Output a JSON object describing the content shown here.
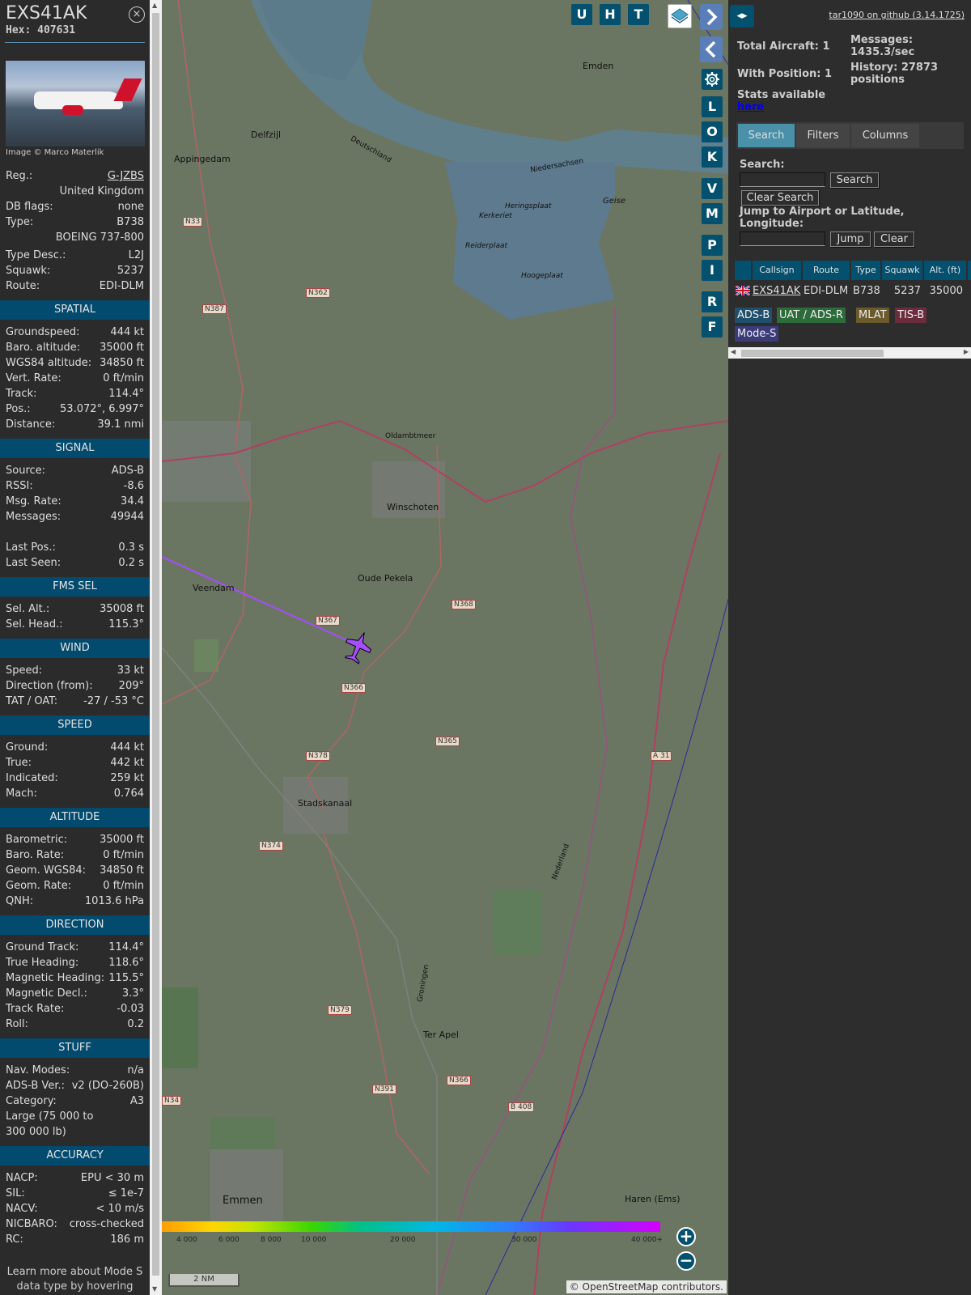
{
  "selected": {
    "callsign": "EXS41AK",
    "hex": "Hex: 407631",
    "close_icon": "×",
    "photo_credit": "Image © Marco Materlik",
    "info": [
      {
        "label": "Reg.:",
        "value": "G-JZBS",
        "link": true
      },
      {
        "label": "",
        "value": "United Kingdom"
      },
      {
        "label": "DB flags:",
        "value": "none"
      },
      {
        "label": "Type:",
        "value": "B738"
      },
      {
        "label": "",
        "value": "BOEING 737-800"
      },
      {
        "label": "Type Desc.:",
        "value": "L2J"
      },
      {
        "label": "Squawk:",
        "value": "5237"
      },
      {
        "label": "Route:",
        "value": "EDI-DLM"
      }
    ],
    "sections": [
      {
        "title": "SPATIAL",
        "rows": [
          {
            "label": "Groundspeed:",
            "value": "444 kt"
          },
          {
            "label": "Baro. altitude:",
            "value": "35000 ft"
          },
          {
            "label": "WGS84 altitude:",
            "value": "34850 ft"
          },
          {
            "label": "Vert. Rate:",
            "value": "0 ft/min"
          },
          {
            "label": "Track:",
            "value": "114.4°"
          },
          {
            "label": "Pos.:",
            "value": "53.072°, 6.997°"
          },
          {
            "label": "Distance:",
            "value": "39.1 nmi"
          }
        ]
      },
      {
        "title": "SIGNAL",
        "rows": [
          {
            "label": "Source:",
            "value": "ADS-B"
          },
          {
            "label": "RSSI:",
            "value": "-8.6"
          },
          {
            "label": "Msg. Rate:",
            "value": "34.4"
          },
          {
            "label": "Messages:",
            "value": "49944"
          },
          {
            "label": "",
            "value": ""
          },
          {
            "label": "Last Pos.:",
            "value": "0.3 s"
          },
          {
            "label": "Last Seen:",
            "value": "0.2 s"
          }
        ]
      },
      {
        "title": "FMS SEL",
        "rows": [
          {
            "label": "Sel. Alt.:",
            "value": "35008 ft"
          },
          {
            "label": "Sel. Head.:",
            "value": "115.3°"
          }
        ]
      },
      {
        "title": "WIND",
        "rows": [
          {
            "label": "Speed:",
            "value": "33 kt"
          },
          {
            "label": "Direction (from):",
            "value": "209°"
          },
          {
            "label": "TAT / OAT:",
            "value": "-27 / -53 °C"
          }
        ]
      },
      {
        "title": "SPEED",
        "rows": [
          {
            "label": "Ground:",
            "value": "444 kt"
          },
          {
            "label": "True:",
            "value": "442 kt"
          },
          {
            "label": "Indicated:",
            "value": "259 kt"
          },
          {
            "label": "Mach:",
            "value": "0.764"
          }
        ]
      },
      {
        "title": "ALTITUDE",
        "rows": [
          {
            "label": "Barometric:",
            "value": "35000 ft"
          },
          {
            "label": "Baro. Rate:",
            "value": "0 ft/min"
          },
          {
            "label": "Geom. WGS84:",
            "value": "34850 ft"
          },
          {
            "label": "Geom. Rate:",
            "value": "0 ft/min"
          },
          {
            "label": "QNH:",
            "value": "1013.6 hPa"
          }
        ]
      },
      {
        "title": "DIRECTION",
        "rows": [
          {
            "label": "Ground Track:",
            "value": "114.4°"
          },
          {
            "label": "True Heading:",
            "value": "118.6°"
          },
          {
            "label": "Magnetic Heading:",
            "value": "115.5°"
          },
          {
            "label": "Magnetic Decl.:",
            "value": "3.3°"
          },
          {
            "label": "Track Rate:",
            "value": "-0.03"
          },
          {
            "label": "Roll:",
            "value": "0.2"
          }
        ]
      },
      {
        "title": "STUFF",
        "rows": [
          {
            "label": "Nav. Modes:",
            "value": "n/a"
          },
          {
            "label": "ADS-B Ver.:",
            "value": "v2 (DO-260B)"
          },
          {
            "label": "Category:",
            "value": "A3"
          },
          {
            "label": "Large (75 000 to",
            "value": ""
          },
          {
            "label": "300 000 lb)",
            "value": ""
          }
        ]
      },
      {
        "title": "ACCURACY",
        "rows": [
          {
            "label": "NACP:",
            "value": "EPU < 30 m"
          },
          {
            "label": "SIL:",
            "value": "≤ 1e-7"
          },
          {
            "label": "NACV:",
            "value": "< 10 m/s"
          },
          {
            "label": "NICBARO:",
            "value": "cross-checked"
          },
          {
            "label": "RC:",
            "value": "186 m"
          }
        ]
      }
    ],
    "learn_more": "Learn more about Mode S data type by hovering over each data label."
  },
  "map": {
    "buttons": [
      "U",
      "H",
      "T"
    ],
    "side_buttons": [
      "L",
      "O",
      "K",
      "V",
      "M",
      "P",
      "I",
      "R",
      "F"
    ],
    "labels": [
      {
        "t": "Emden"
      },
      {
        "t": "Delfzijl"
      },
      {
        "t": "Appingedam"
      },
      {
        "t": "Winschoten"
      },
      {
        "t": "Oude Pekela"
      },
      {
        "t": "Veendam"
      },
      {
        "t": "Stadskanaal"
      },
      {
        "t": "Ter Apel"
      },
      {
        "t": "Emmen"
      },
      {
        "t": "Haren (Ems)"
      },
      {
        "t": "Oldambtmeer"
      },
      {
        "t": "Deutschland"
      },
      {
        "t": "Niedersachsen"
      },
      {
        "t": "Nederland"
      },
      {
        "t": "Groningen"
      },
      {
        "t": "Geise"
      },
      {
        "t": "Kerkeriet"
      },
      {
        "t": "Reiderplaat"
      },
      {
        "t": "Heringsplaat"
      },
      {
        "t": "Hoogeplaat"
      }
    ],
    "roads": [
      "N33",
      "N362",
      "N387",
      "N367",
      "N368",
      "N366",
      "N365",
      "N378",
      "N374",
      "N379",
      "N391",
      "N366",
      "B 408",
      "A 31",
      "N34"
    ],
    "colorbar_labels": [
      "4 000",
      "6 000",
      "8 000",
      "10 000",
      "20 000",
      "30 000",
      "40 000+"
    ],
    "scale": "2 NM",
    "attribution": "© OpenStreetMap contributors."
  },
  "side": {
    "github": "tar1090 on github (3.14.1725)",
    "total_aircraft": "Total Aircraft: 1",
    "with_position": "With Position: 1",
    "messages": "Messages: 1435.3/sec",
    "history": "History: 27873 positions",
    "stats_avail": "Stats available",
    "stats_link": "here",
    "tabs": [
      "Search",
      "Filters",
      "Columns"
    ],
    "search_label": "Search:",
    "search_btn": "Search",
    "clear_search_btn": "Clear Search",
    "jump_label": "Jump to Airport or Latitude, Longitude:",
    "jump_btn": "Jump",
    "clear_btn": "Clear",
    "columns": [
      "Callsign",
      "Route",
      "Type",
      "Squawk",
      "Alt. (ft)"
    ],
    "row": {
      "callsign": "EXS41AK",
      "route": "EDI-DLM",
      "type": "B738",
      "squawk": "5237",
      "alt": "35000"
    },
    "legend": [
      {
        "t": "ADS-B",
        "c": "#1f4f6a"
      },
      {
        "t": "UAT / ADS-R",
        "c": "#2c6b3a"
      },
      {
        "t": "MLAT",
        "c": "#6b5a2c"
      },
      {
        "t": "TIS-B",
        "c": "#6b2c3e"
      },
      {
        "t": "Mode-S",
        "c": "#3b3b7a"
      }
    ]
  }
}
